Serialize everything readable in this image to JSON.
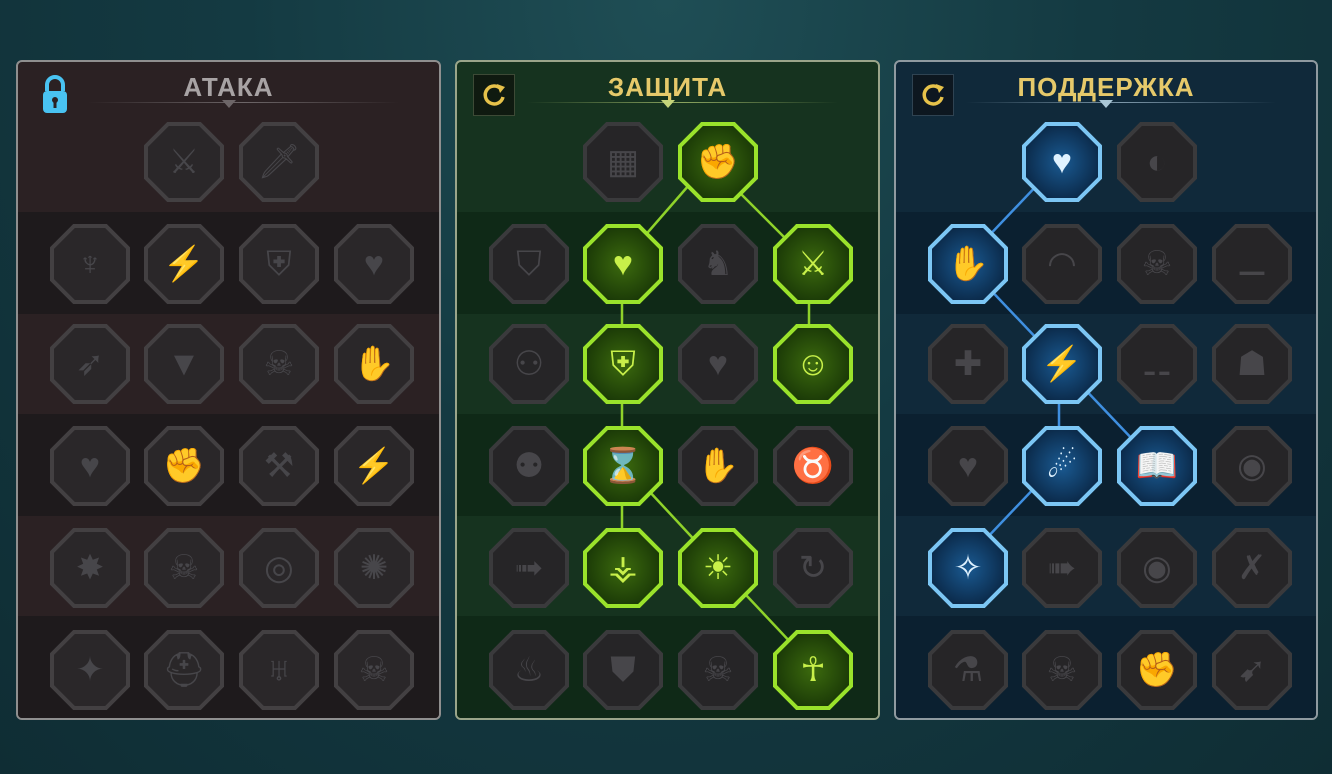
{
  "panels": {
    "attack": {
      "title": "АТАКА",
      "corner_icon": "lock-icon",
      "nodes": [
        [
          "",
          "crossed-swords-icon",
          "daggers-icon",
          ""
        ],
        [
          "horned-figure-icon",
          "blade-slash-icon",
          "shield-arrow-icon",
          "heart-spikes-icon"
        ],
        [
          "arrows-body-icon",
          "fangs-icon",
          "skull-icon",
          "hand-blade-icon"
        ],
        [
          "heart-sword-icon",
          "fist-icon",
          "axe-icon",
          "chain-lightning-icon"
        ],
        [
          "sword-burst-icon",
          "triple-skull-icon",
          "sword-arc-icon",
          "body-burst-icon"
        ],
        [
          "sword-sparkle-icon",
          "helmet-face-icon",
          "demon-icon",
          "skull-crest-icon"
        ]
      ]
    },
    "defense": {
      "title": "ЗАЩИТА",
      "corner_icon": "reset-icon",
      "colors": {
        "active_border": "#9ae22b",
        "active_glyph": "#c8f04a"
      }
    },
    "support": {
      "title": "ПОДДЕРЖКА",
      "corner_icon": "reset-icon",
      "colors": {
        "active_border": "#7cc6f4",
        "active_glyph": "#dff2ff"
      }
    }
  },
  "glyphs": {
    "crossed-swords-icon": "⚔",
    "daggers-icon": "🗡",
    "horned-figure-icon": "♆",
    "blade-slash-icon": "⚡",
    "shield-arrow-icon": "⛨",
    "heart-spikes-icon": "♥",
    "arrows-body-icon": "➶",
    "fangs-icon": "▼",
    "skull-icon": "☠",
    "hand-blade-icon": "✋",
    "heart-sword-icon": "♥",
    "fist-icon": "✊",
    "axe-icon": "⚒",
    "chain-lightning-icon": "⚡",
    "sword-burst-icon": "✸",
    "triple-skull-icon": "☠",
    "sword-arc-icon": "◎",
    "body-burst-icon": "✺",
    "sword-sparkle-icon": "✦",
    "helmet-face-icon": "⛑",
    "demon-icon": "♅",
    "skull-crest-icon": "☠",
    "armor-plates-icon": "▦",
    "raised-fist-icon": "✊",
    "chest-armor-icon": "⛉",
    "burning-heart-icon": "♥",
    "ogre-icon": "♞",
    "crossed-blades-icon": "⚔",
    "figure-pair-icon": "⚇",
    "knight-shield-icon": "⛨",
    "skull-heart-icon": "♥",
    "halo-face-icon": "☺",
    "crowd-icon": "⚉",
    "hourglass-icon": "⌛",
    "hand-icon": "✋",
    "bull-icon": "♉",
    "running-figure-icon": "➟",
    "claw-drops-icon": "⚶",
    "sun-skull-icon": "☀",
    "arrow-swirl-icon": "↻",
    "fiery-face-icon": "♨",
    "bracer-shield-icon": "⛊",
    "bearded-skull-icon": "☠",
    "strong-figure-icon": "☥",
    "heart-plus-icon": "♥",
    "crescent-eye-icon": "◐",
    "praying-hands-icon": "✋",
    "dome-shield-icon": "◠",
    "swirl-skull-icon": "☠",
    "boot-icon": "⚊",
    "healing-figure-icon": "✚",
    "lightning-icon": "⚡",
    "broken-legs-icon": "⚋",
    "bald-figure-icon": "☗",
    "chained-heart-icon": "♥",
    "meteor-icon": "☄",
    "open-book-icon": "📖",
    "angry-eyes-icon": "◉",
    "compass-star-icon": "✧",
    "speed-boot-icon": "➠",
    "eye-icon": "◉",
    "broken-figure-icon": "✗",
    "potion-icon": "⚗",
    "skull-dark-icon": "☠",
    "fist-crest-icon": "✊",
    "eagle-icon": "➹"
  }
}
